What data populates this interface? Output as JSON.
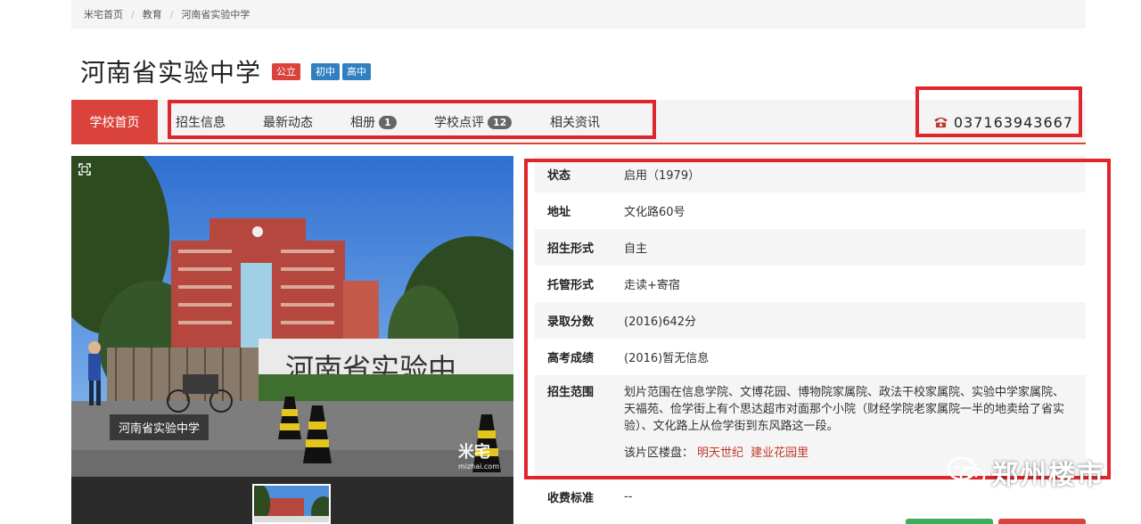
{
  "breadcrumb": {
    "items": [
      "米宅首页",
      "教育",
      "河南省实验中学"
    ],
    "separator": "/"
  },
  "school": {
    "name": "河南省实验中学",
    "type_badge": "公立",
    "level_badges": [
      "初中",
      "高中"
    ]
  },
  "nav": {
    "home": "学校首页",
    "items": [
      {
        "label": "招生信息"
      },
      {
        "label": "最新动态"
      },
      {
        "label": "相册",
        "count": "1"
      },
      {
        "label": "学校点评",
        "count": "12"
      },
      {
        "label": "相关资讯"
      }
    ],
    "phone": "037163943667",
    "phone_icon": "phone-icon"
  },
  "photo": {
    "caption": "河南省实验中学",
    "watermark": "米宅",
    "watermark_sub": "mizhai.com",
    "gate_text": "河南省实验中",
    "thumbnail_count": 1
  },
  "info": {
    "rows": [
      {
        "label": "状态",
        "value": "启用（1979）"
      },
      {
        "label": "地址",
        "value": "文化路60号"
      },
      {
        "label": "招生形式",
        "value": "自主"
      },
      {
        "label": "托管形式",
        "value": "走读+寄宿"
      },
      {
        "label": "录取分数",
        "value": "(2016)642分"
      },
      {
        "label": "高考成绩",
        "value": "(2016)暂无信息"
      }
    ],
    "scope": {
      "label": "招生范围",
      "value": "划片范围在信息学院、文博花园、博物院家属院、政法干校家属院、实验中学家属院、天福苑、俭学街上有个思达超市对面那个小院（财经学院老家属院一半的地卖给了省实验）、文化路上从俭学街到东风路这一段。",
      "loupan_label": "该片区楼盘：",
      "loupan_links": [
        "明天世纪",
        "建业花园里"
      ]
    },
    "fee": {
      "label": "收费标准",
      "value": "--"
    }
  },
  "overlay": {
    "watermark": "郑州楼市"
  },
  "colors": {
    "accent_red": "#d9433b",
    "badge_blue": "#2f7fc1",
    "annotation_red": "#e0262d",
    "link_red": "#c0392b"
  }
}
